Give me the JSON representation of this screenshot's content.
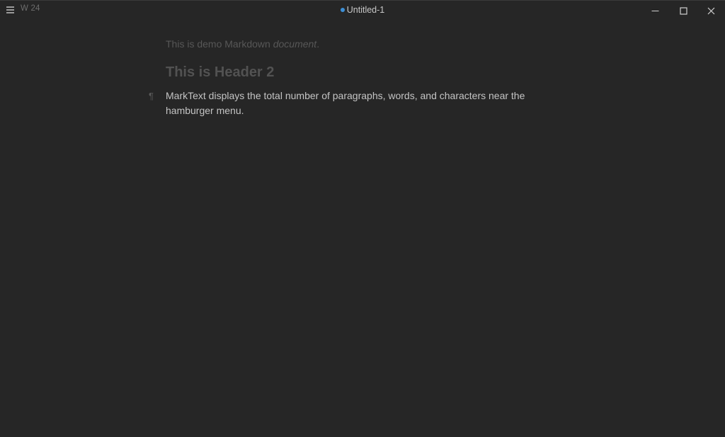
{
  "titlebar": {
    "word_count": "W 24",
    "title": "Untitled-1",
    "unsaved_dot_color": "#3d8fd6",
    "menu_icon": "hamburger-icon",
    "controls": [
      "minimize-icon",
      "maximize-icon",
      "close-icon"
    ]
  },
  "document": {
    "line1_prefix": "This is demo Markdown ",
    "line1_em": "document",
    "line1_suffix": ".",
    "header2": "This is Header 2",
    "paragraph_marker": "¶",
    "paragraph": "MarkText displays the total number of paragraphs, words, and characters near the hamburger menu."
  }
}
